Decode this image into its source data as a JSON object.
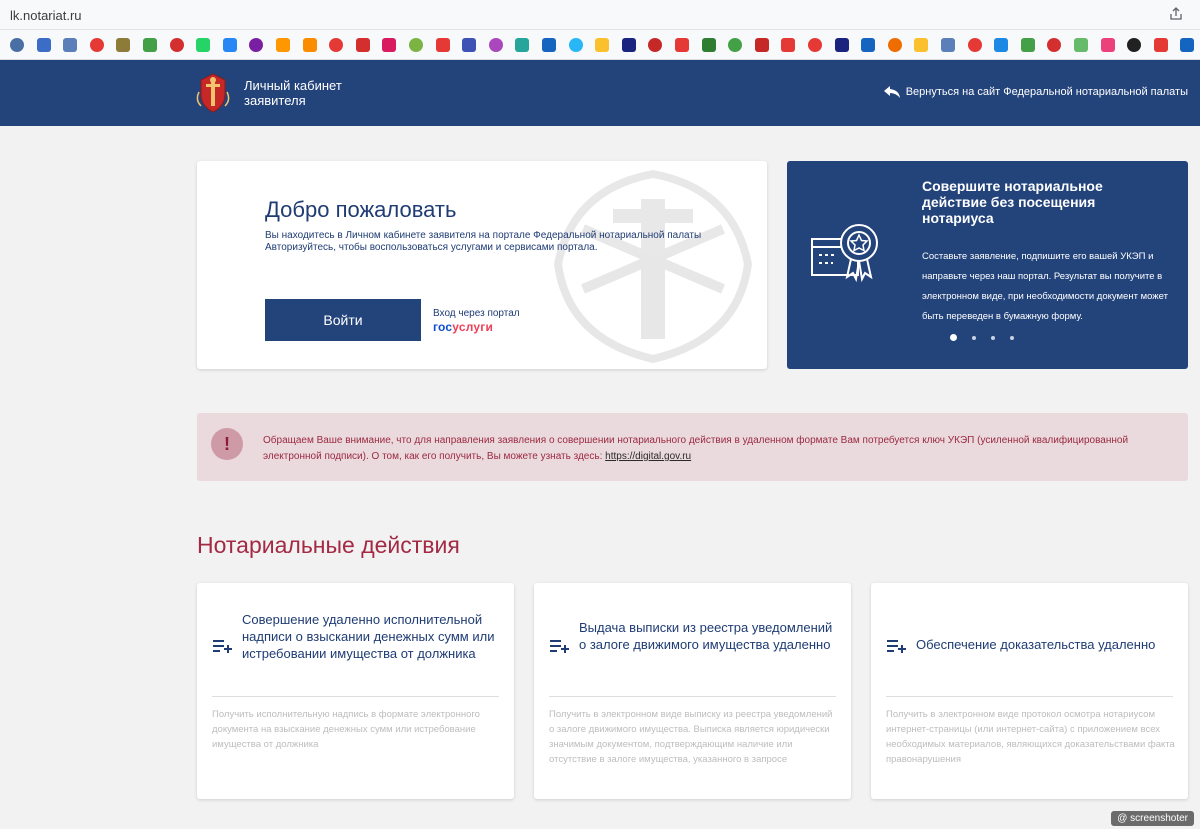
{
  "browser": {
    "url": "lk.notariat.ru",
    "share_icon": "share-icon",
    "bookmark_colors": [
      "#4a6fa5",
      "#3b6cc6",
      "#5b7fb8",
      "#e53935",
      "#8d7b3a",
      "#43a047",
      "#d32f2f",
      "#25d366",
      "#2787f5",
      "#7b1fa2",
      "#ff9800",
      "#fb8c00",
      "#e53935",
      "#d32f2f",
      "#d81b60",
      "#7cb342",
      "#e53935",
      "#3f51b5",
      "#ab47bc",
      "#26a69a",
      "#1565c0",
      "#29b6f6",
      "#fbc02d",
      "#1a237e",
      "#c62828",
      "#e53935",
      "#2e7d32",
      "#43a047",
      "#c62828",
      "#e53935",
      "#e53935",
      "#1a237e",
      "#1565c0",
      "#ef6c00",
      "#fbc02d",
      "#5b7fb8",
      "#e53935",
      "#1e88e5",
      "#43a047",
      "#d32f2f",
      "#66bb6a",
      "#ec407a",
      "#212121",
      "#e53935",
      "#1565c0",
      "#e53935"
    ]
  },
  "header": {
    "brand_line1": "Личный кабинет",
    "brand_line2": "заявителя",
    "back_link": "Вернуться на сайт Федеральной нотариальной палаты",
    "logo_icon": "notary-emblem-icon",
    "back_icon": "reply-arrow-icon"
  },
  "welcome": {
    "title": "Добро пожаловать",
    "desc_line1": "Вы находитесь в Личном кабинете заявителя на портале Федеральной нотариальной палаты",
    "desc_line2": "Авторизуйтесь, чтобы воспользоваться услугами и сервисами портала.",
    "login_button": "Войти",
    "gos_caption": "Вход через портал",
    "gos_logo_part1": "гос",
    "gos_logo_part2": "услуги"
  },
  "promo": {
    "title": "Совершите нотариальное действие без посещения нотариуса",
    "text": "Составьте заявление, подпишите его вашей УКЭП и направьте через наш портал. Результат вы получите в электронном виде, при необходимости документ может быть переведен в бумажную форму.",
    "icon": "certificate-badge-icon",
    "slides_total": 4,
    "active_slide": 1
  },
  "alert": {
    "icon": "!",
    "text": "Обращаем Ваше внимание, что для направления заявления о совершении нотариального действия в удаленном формате Вам потребуется ключ УКЭП (усиленной квалифицированной электронной подписи). О том, как его получить, Вы можете узнать здесь: ",
    "link": "https://digital.gov.ru"
  },
  "section": {
    "title": "Нотариальные действия"
  },
  "actions": [
    {
      "title": "Совершение удаленно исполнительной надписи о взыскании денежных сумм или истребовании имущества от должника",
      "text": "Получить исполнительную надпись в формате электронного документа на взыскание денежных сумм или истребование имущества от должника"
    },
    {
      "title": "Выдача выписки из реестра уведомлений о залоге движимого имущества удаленно",
      "text": "Получить в электронном виде выписку из реестра уведомлений о залоге движимого имущества. Выписка является юридически значимым документом, подтверждающим наличие или отсутствие в залоге имущества, указанного в запросе"
    },
    {
      "title": "Обеспечение доказательства удаленно",
      "text": "Получить в электронном виде протокол осмотра нотариусом интернет-страницы (или интернет-сайта) с приложением всех необходимых материалов, являющихся доказательствами факта правонарушения"
    }
  ],
  "watermark": "@ screenshoter"
}
